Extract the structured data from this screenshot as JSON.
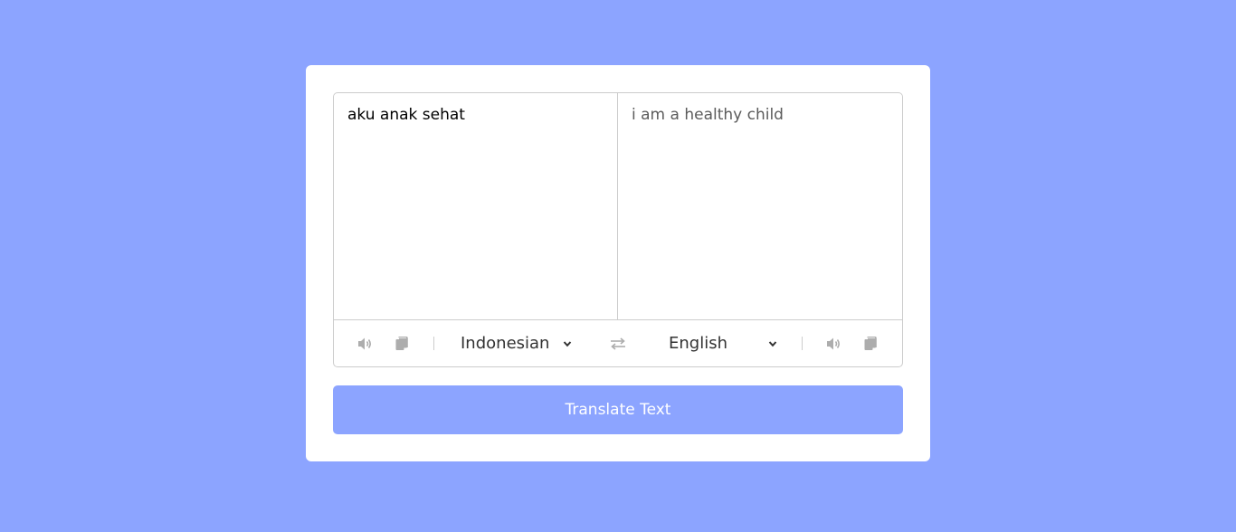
{
  "input": {
    "source_text": "aku anak sehat",
    "translated_text": "i am a healthy child"
  },
  "controls": {
    "source_language": "Indonesian",
    "target_language": "English"
  },
  "actions": {
    "translate_label": "Translate Text"
  },
  "icons": {
    "speak": "volume-icon",
    "copy": "copy-icon",
    "swap": "exchange-icon",
    "dropdown": "chevron-down-icon"
  },
  "colors": {
    "background": "#8ca4ff",
    "card": "#ffffff",
    "button": "#8ca4ff",
    "icon": "#adadad"
  }
}
